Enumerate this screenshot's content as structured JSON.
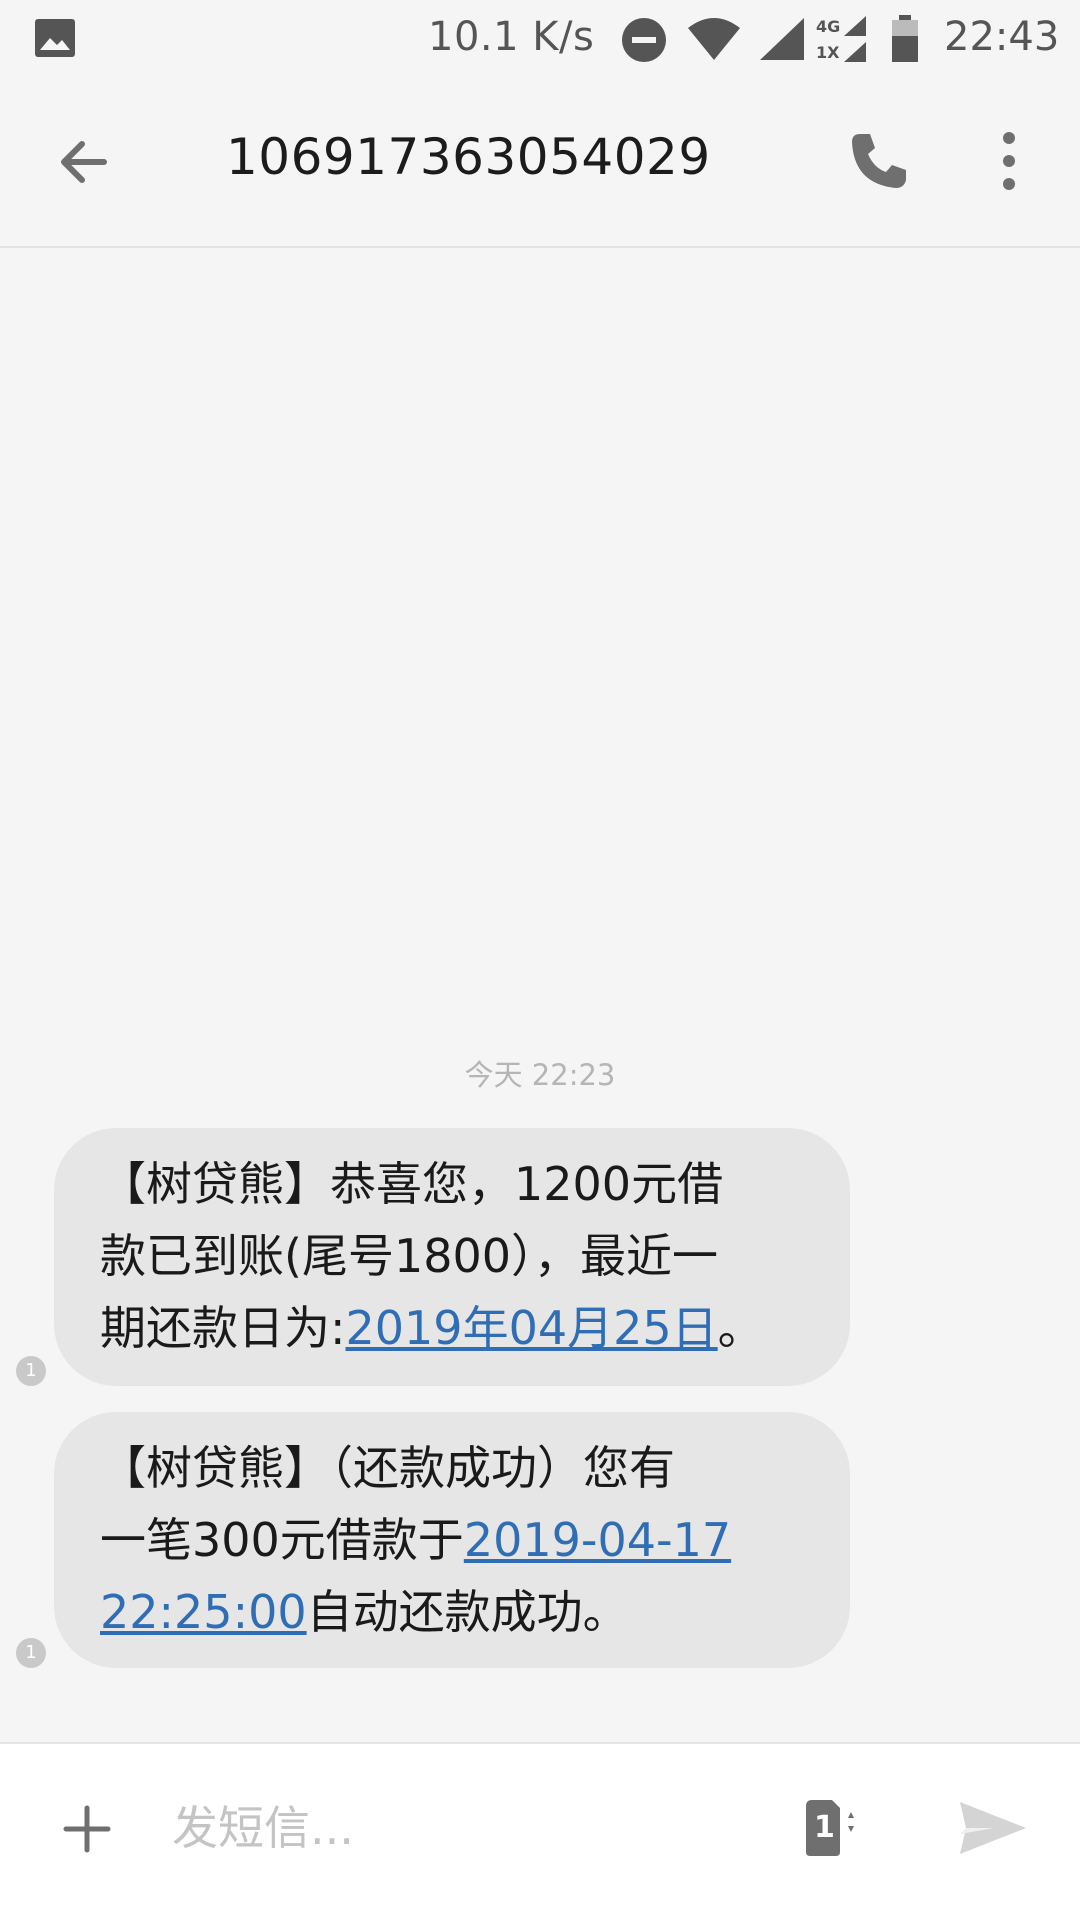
{
  "status_bar": {
    "net_speed": "10.1 K/s",
    "clock": "22:43",
    "icons": [
      "gallery-icon",
      "dnd-icon",
      "wifi-icon",
      "signal-icon",
      "signal-4g-1x-icon",
      "battery-icon"
    ],
    "network_labels": [
      "4G",
      "1X"
    ]
  },
  "app_bar": {
    "title": "106917363054029",
    "icons": [
      "back-arrow-icon",
      "phone-icon",
      "more-vert-icon"
    ]
  },
  "conversation": {
    "timestamp": "今天 22:23",
    "messages": [
      {
        "lines": [
          {
            "text": "【树贷熊】恭喜您，1200元借"
          },
          {
            "text": "款已到账(尾号1800），最近一"
          },
          {
            "prefix": "期还款日为:",
            "link": "2019年04月25日",
            "suffix": "。"
          }
        ],
        "sim": "1"
      },
      {
        "lines": [
          {
            "text": "【树贷熊】（还款成功）您有"
          },
          {
            "prefix": "一笔300元借款于",
            "link": "2019-04-17",
            "suffix": ""
          },
          {
            "prefix": "",
            "link": "22:25:00",
            "suffix": "自动还款成功。"
          }
        ],
        "sim": "1"
      }
    ]
  },
  "compose": {
    "placeholder": "发短信...",
    "sim_label": "1",
    "icons": [
      "plus-icon",
      "sim-card-icon",
      "send-icon"
    ]
  },
  "colors": {
    "background": "#f5f5f5",
    "bubble": "#e6e6e6",
    "link": "#2f6db5",
    "icon_gray": "#6f6f6f"
  }
}
